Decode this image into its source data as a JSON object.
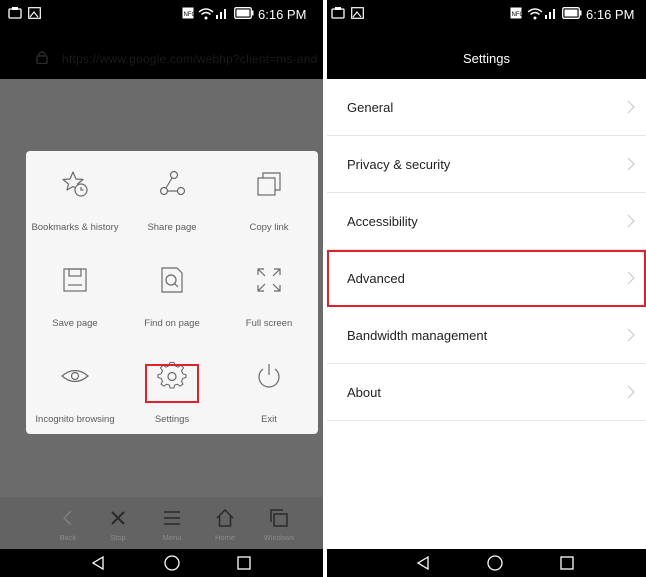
{
  "left": {
    "status_bar": {
      "time": "6:16 PM"
    },
    "url_bar": {
      "url": "https://www.google.com/webhp?client=ms-and"
    },
    "menu": {
      "items": [
        {
          "label": "Bookmarks & history",
          "icon": "bookmark-history-icon"
        },
        {
          "label": "Share page",
          "icon": "share-icon"
        },
        {
          "label": "Copy link",
          "icon": "copy-link-icon"
        },
        {
          "label": "Save page",
          "icon": "save-icon"
        },
        {
          "label": "Find on page",
          "icon": "find-on-page-icon"
        },
        {
          "label": "Full screen",
          "icon": "full-screen-icon"
        },
        {
          "label": "Incognito browsing",
          "icon": "eye-icon"
        },
        {
          "label": "Settings",
          "icon": "gear-icon"
        },
        {
          "label": "Exit",
          "icon": "power-icon"
        }
      ]
    },
    "bottom_bar": {
      "items": [
        {
          "label": "Back",
          "icon": "back-icon"
        },
        {
          "label": "Stop",
          "icon": "close-icon"
        },
        {
          "label": "Menu",
          "icon": "menu-icon"
        },
        {
          "label": "Home",
          "icon": "home-icon"
        },
        {
          "label": "Windows",
          "icon": "windows-icon"
        }
      ]
    }
  },
  "right": {
    "status_bar": {
      "time": "6:16 PM"
    },
    "title": "Settings",
    "settings": [
      {
        "label": "General"
      },
      {
        "label": "Privacy & security"
      },
      {
        "label": "Accessibility"
      },
      {
        "label": "Advanced",
        "highlighted": true
      },
      {
        "label": "Bandwidth management"
      },
      {
        "label": "About"
      }
    ]
  },
  "colors": {
    "highlight": "#e0202a",
    "dim_background": "#6b6b6b",
    "popup_background": "#f6f6f6",
    "bar_background": "#000000"
  }
}
